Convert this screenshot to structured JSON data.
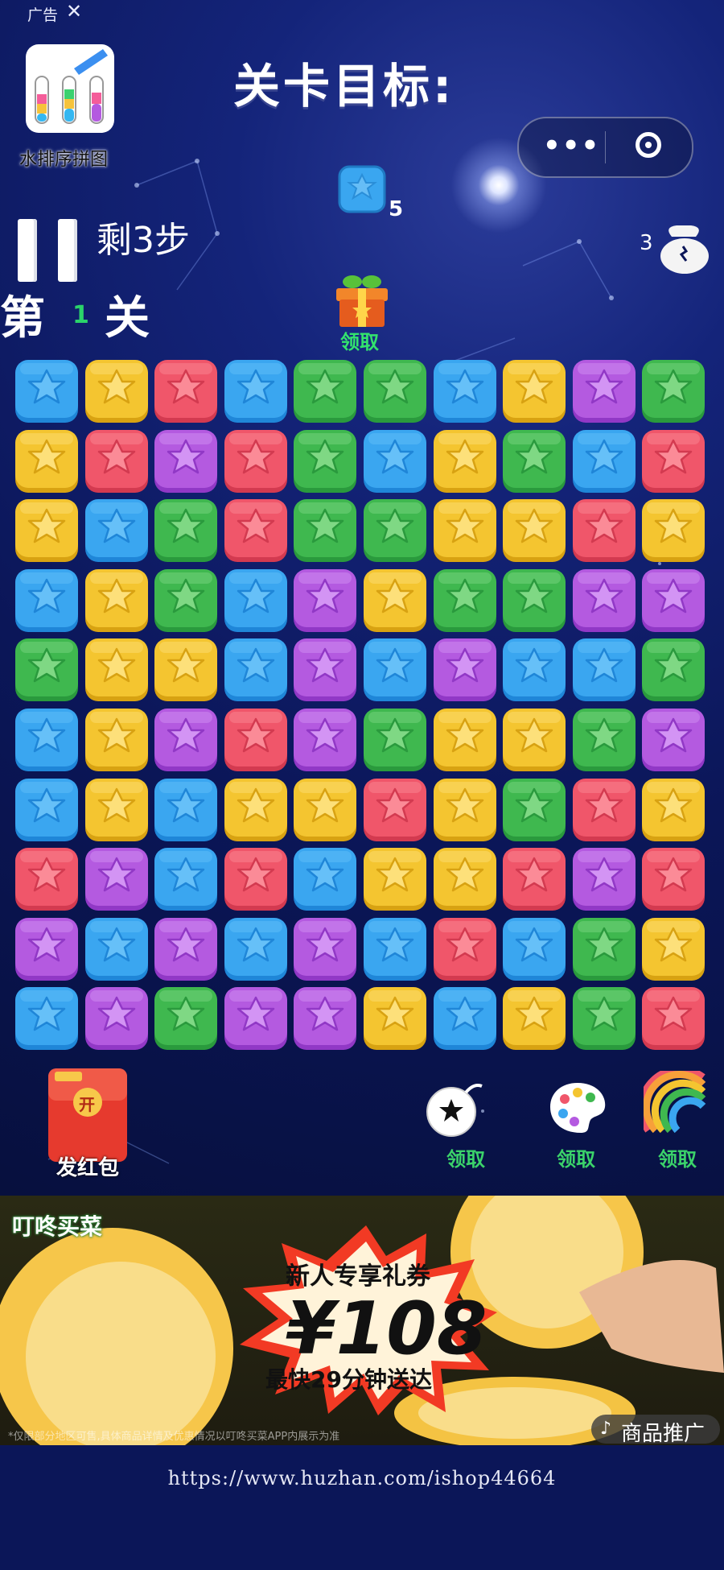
{
  "ad_header": {
    "tag": "广告",
    "close": "✕",
    "app_name": "水排序拼图"
  },
  "goal": {
    "title": "关卡目标:",
    "tile_color": "blue",
    "count": "5"
  },
  "capsule": {
    "more": "•••",
    "icon": "target-icon"
  },
  "hud": {
    "steps": "剩3步",
    "level_prefix": "第",
    "level_number": "1",
    "level_suffix": "关"
  },
  "gift": {
    "label": "领取"
  },
  "colors": {
    "blue": "#3aa6f0",
    "yellow": "#f4c530",
    "red": "#f0566a",
    "green": "#3fb84f",
    "purple": "#b45ae0"
  },
  "board": [
    [
      "blue",
      "yellow",
      "red",
      "blue",
      "green",
      "green",
      "blue",
      "yellow",
      "purple",
      "green"
    ],
    [
      "yellow",
      "red",
      "purple",
      "red",
      "green",
      "blue",
      "yellow",
      "green",
      "blue",
      "red"
    ],
    [
      "yellow",
      "blue",
      "green",
      "red",
      "green",
      "green",
      "yellow",
      "yellow",
      "red",
      "yellow"
    ],
    [
      "blue",
      "yellow",
      "green",
      "blue",
      "purple",
      "yellow",
      "green",
      "green",
      "purple",
      "purple"
    ],
    [
      "green",
      "yellow",
      "yellow",
      "blue",
      "purple",
      "blue",
      "purple",
      "blue",
      "blue",
      "green"
    ],
    [
      "blue",
      "yellow",
      "purple",
      "red",
      "purple",
      "green",
      "yellow",
      "yellow",
      "green",
      "purple"
    ],
    [
      "blue",
      "yellow",
      "blue",
      "yellow",
      "yellow",
      "red",
      "yellow",
      "green",
      "red",
      "yellow"
    ],
    [
      "red",
      "purple",
      "blue",
      "red",
      "blue",
      "yellow",
      "yellow",
      "red",
      "purple",
      "red"
    ],
    [
      "purple",
      "blue",
      "purple",
      "blue",
      "purple",
      "blue",
      "red",
      "blue",
      "green",
      "yellow"
    ],
    [
      "blue",
      "purple",
      "green",
      "purple",
      "purple",
      "yellow",
      "blue",
      "yellow",
      "green",
      "red"
    ]
  ],
  "bottom": {
    "hongbao_open": "开",
    "hongbao_label": "发红包",
    "tools": [
      {
        "name": "bomb",
        "label": "领取"
      },
      {
        "name": "palette",
        "label": "领取"
      },
      {
        "name": "rainbow",
        "label": "领取"
      }
    ]
  },
  "banner": {
    "brand": "叮咚买菜",
    "line1": "新人专享礼券",
    "amount": "¥108",
    "line3": "最快29分钟送达",
    "fine_print": "*仅限部分地区可售,具体商品详情及优惠情况以叮咚买菜APP内展示为准",
    "promo": "商品推广"
  },
  "footer": {
    "url": "https://www.huzhan.com/ishop44664"
  }
}
